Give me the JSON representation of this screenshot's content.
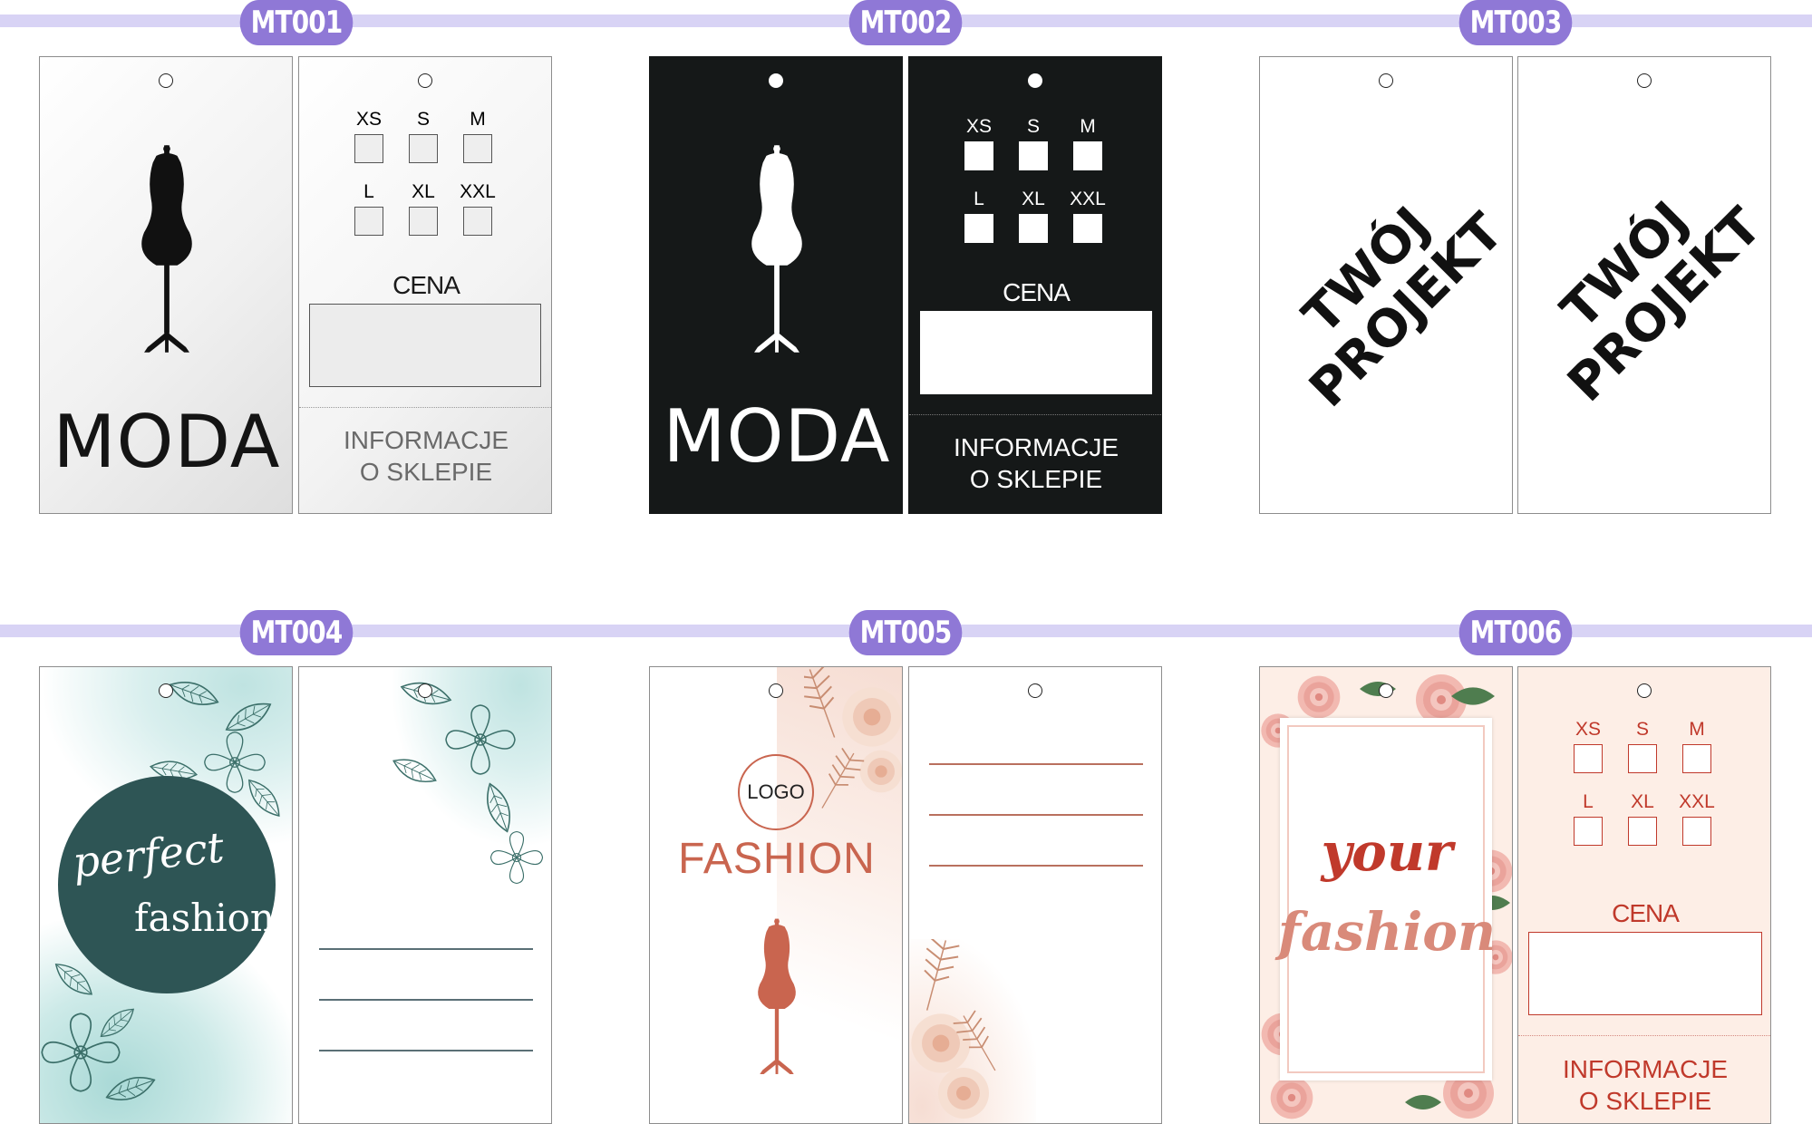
{
  "designs": [
    {
      "code": "MT001",
      "brand": "MODA",
      "sizes_row1": [
        "XS",
        "S",
        "M"
      ],
      "sizes_row2": [
        "L",
        "XL",
        "XXL"
      ],
      "price_label": "CENA",
      "info_line1": "INFORMACJE",
      "info_line2": "O SKLEPIE"
    },
    {
      "code": "MT002",
      "brand": "MODA",
      "sizes_row1": [
        "XS",
        "S",
        "M"
      ],
      "sizes_row2": [
        "L",
        "XL",
        "XXL"
      ],
      "price_label": "CENA",
      "info_line1": "INFORMACJE",
      "info_line2": "O SKLEPIE"
    },
    {
      "code": "MT003",
      "placeholder_line1": "TWÓJ",
      "placeholder_line2": "PROJEKT"
    },
    {
      "code": "MT004",
      "title_line1": "perfect",
      "title_line2": "fashion"
    },
    {
      "code": "MT005",
      "logo": "LOGO",
      "brand": "FASHION"
    },
    {
      "code": "MT006",
      "title_line1": "your",
      "title_line2": "fashion",
      "sizes_row1": [
        "XS",
        "S",
        "M"
      ],
      "sizes_row2": [
        "L",
        "XL",
        "XXL"
      ],
      "price_label": "CENA",
      "info_line1": "INFORMACJE",
      "info_line2": "O SKLEPIE"
    }
  ],
  "colors": {
    "label_pill": "#8f78d6",
    "label_strip": "#d8d3f5",
    "mt002_bg": "#151818",
    "mt004_teal": "#2e5555",
    "mt005_terracotta": "#c9654f",
    "mt006_red": "#c0392b"
  }
}
